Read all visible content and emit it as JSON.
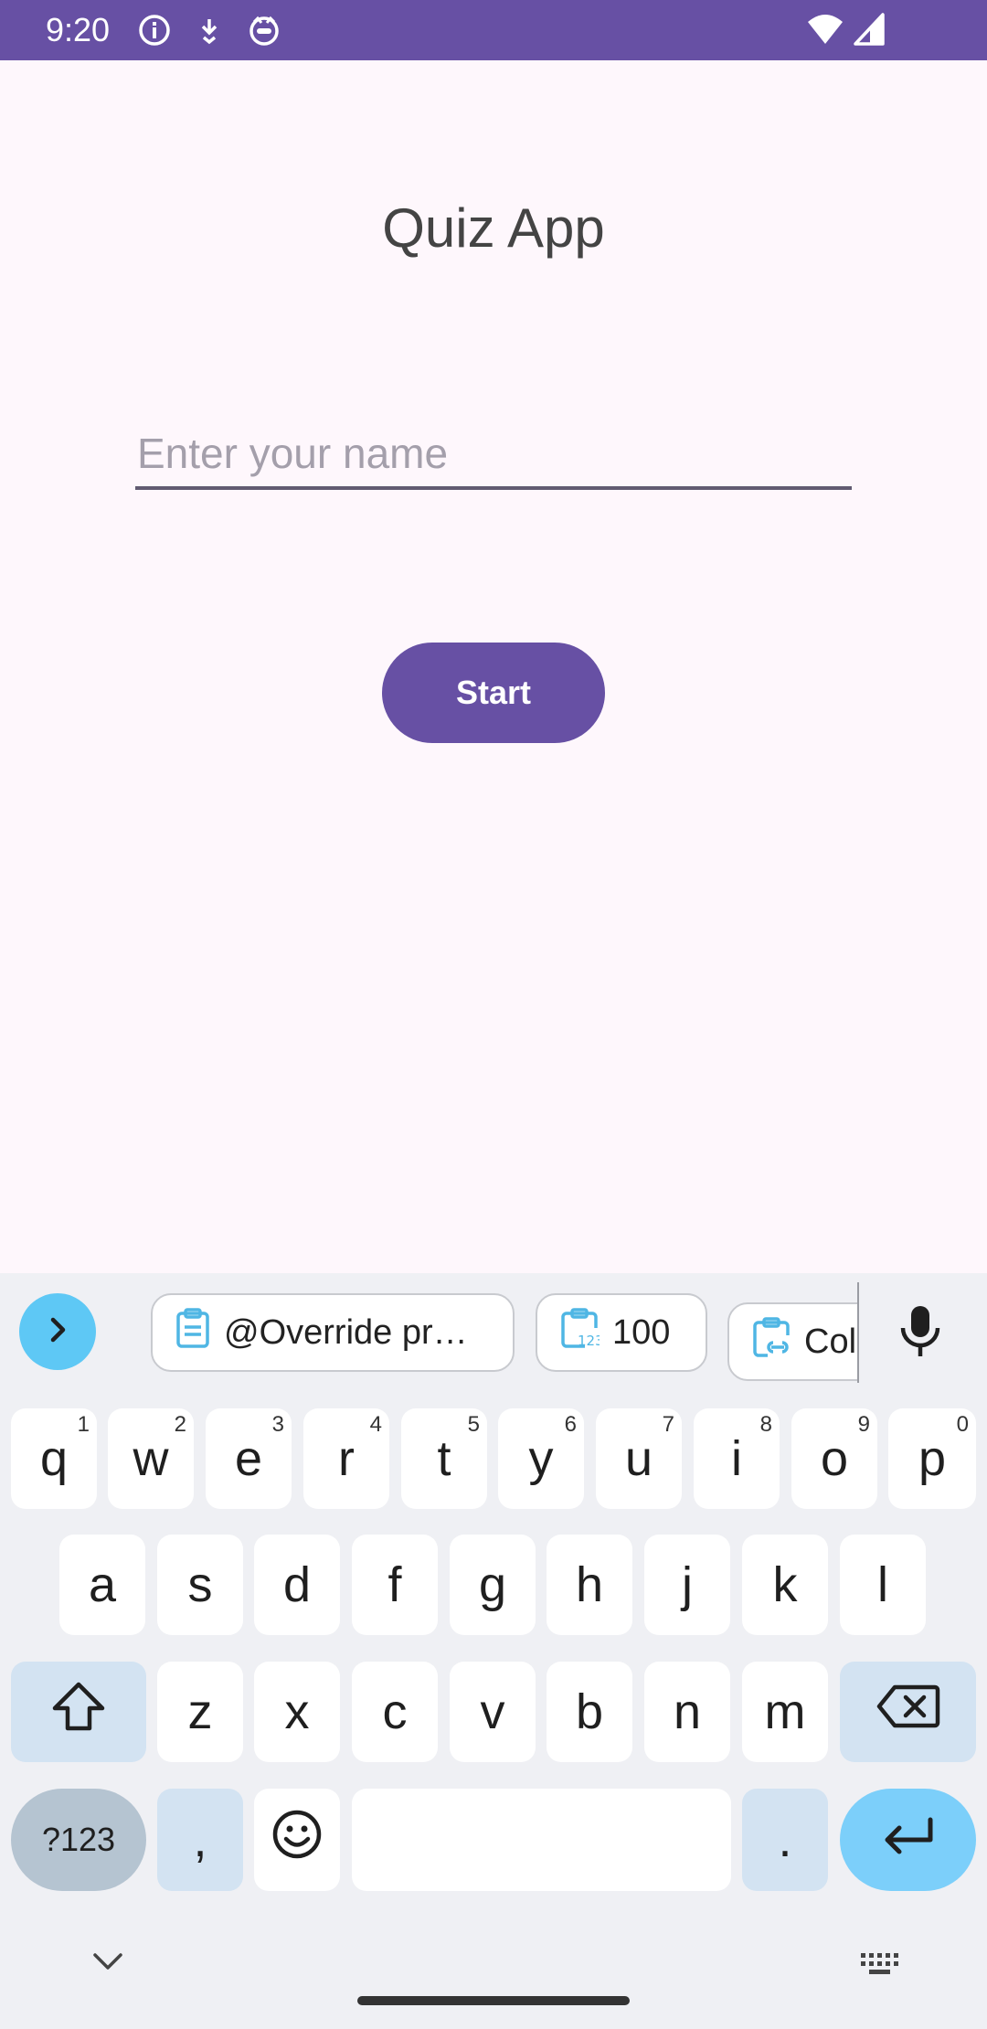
{
  "status_bar": {
    "time": "9:20",
    "color": "#6750a4",
    "left_icons": [
      "info-icon",
      "download-icon",
      "cat-face-icon"
    ],
    "right_icons": [
      "wifi-icon",
      "signal-icon"
    ]
  },
  "app": {
    "title": "Quiz App",
    "name_input": {
      "placeholder": "Enter your name",
      "value": ""
    },
    "start_button": "Start",
    "accent_color": "#6750a4",
    "background_color": "#fef7fc"
  },
  "keyboard": {
    "suggestions": [
      {
        "icon": "clipboard-icon",
        "text": "@Override pr…"
      },
      {
        "icon": "clipboard-number-icon",
        "text": "100"
      },
      {
        "icon": "clipboard-link-icon",
        "text": "Col"
      }
    ],
    "row1": [
      {
        "label": "q",
        "hint": "1"
      },
      {
        "label": "w",
        "hint": "2"
      },
      {
        "label": "e",
        "hint": "3"
      },
      {
        "label": "r",
        "hint": "4"
      },
      {
        "label": "t",
        "hint": "5"
      },
      {
        "label": "y",
        "hint": "6"
      },
      {
        "label": "u",
        "hint": "7"
      },
      {
        "label": "i",
        "hint": "8"
      },
      {
        "label": "o",
        "hint": "9"
      },
      {
        "label": "p",
        "hint": "0"
      }
    ],
    "row2": [
      "a",
      "s",
      "d",
      "f",
      "g",
      "h",
      "j",
      "k",
      "l"
    ],
    "row3": [
      "z",
      "x",
      "c",
      "v",
      "b",
      "n",
      "m"
    ],
    "symbols_key": "?123",
    "comma_key": ",",
    "period_key": ".",
    "enter_color": "#7ccffa"
  }
}
